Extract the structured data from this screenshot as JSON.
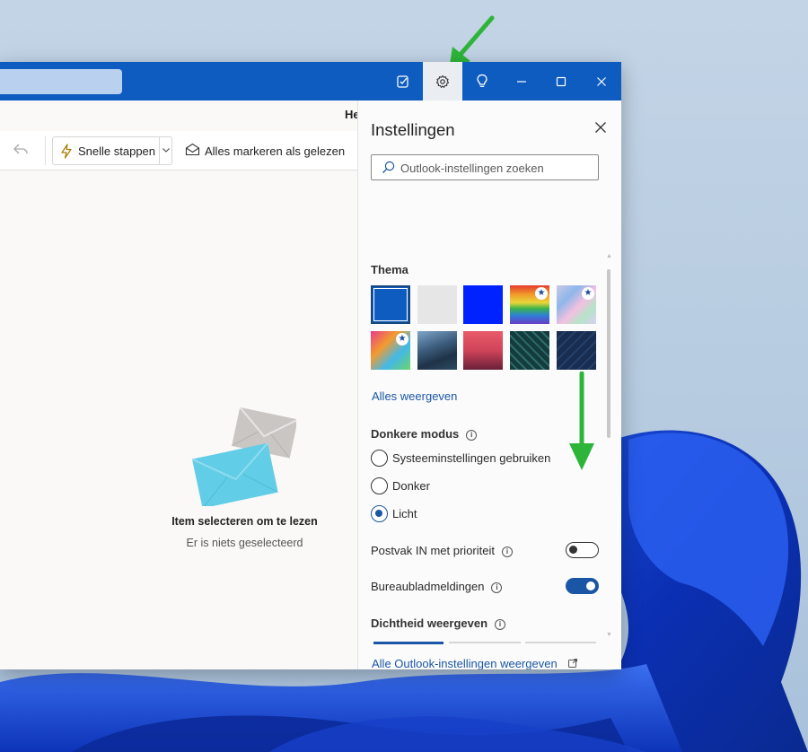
{
  "colors": {
    "titlebar": "#0f5cc0",
    "accent": "#1b56a6",
    "annotation_arrow": "#2db53a"
  },
  "titlebar": {
    "icons": [
      "todo-icon",
      "settings-icon",
      "lightbulb-icon",
      "minimize-icon",
      "maximize-icon",
      "close-icon"
    ]
  },
  "main": {
    "heading_fragment": "He",
    "commands": {
      "quick_steps": "Snelle stappen",
      "mark_all_read": "Alles markeren als gelezen"
    },
    "empty_state": {
      "title": "Item selecteren om te lezen",
      "subtitle": "Er is niets geselecteerd"
    }
  },
  "settings": {
    "title": "Instellingen",
    "search_placeholder": "Outlook-instellingen zoeken",
    "theme": {
      "label": "Thema",
      "show_all": "Alles weergeven",
      "tiles": [
        {
          "name": "blue",
          "selected": true,
          "premium": false
        },
        {
          "name": "light-gray",
          "selected": false,
          "premium": false
        },
        {
          "name": "bright-blue",
          "selected": false,
          "premium": false
        },
        {
          "name": "rainbow",
          "selected": false,
          "premium": true
        },
        {
          "name": "prism",
          "selected": false,
          "premium": true
        },
        {
          "name": "colorful-art",
          "selected": false,
          "premium": true
        },
        {
          "name": "mountain",
          "selected": false,
          "premium": false
        },
        {
          "name": "palm-sunset",
          "selected": false,
          "premium": false
        },
        {
          "name": "circuit",
          "selected": false,
          "premium": false
        },
        {
          "name": "navy-pattern",
          "selected": false,
          "premium": false
        }
      ]
    },
    "dark_mode": {
      "label": "Donkere modus",
      "options": [
        {
          "label": "Systeeminstellingen gebruiken",
          "selected": false
        },
        {
          "label": "Donker",
          "selected": false
        },
        {
          "label": "Licht",
          "selected": true
        }
      ]
    },
    "focused_inbox": {
      "label": "Postvak IN met prioriteit",
      "on": false
    },
    "desktop_notifications": {
      "label": "Bureaubladmeldingen",
      "on": true
    },
    "density": {
      "label": "Dichtheid weergeven"
    },
    "all_settings_link": "Alle Outlook-instellingen weergeven"
  }
}
